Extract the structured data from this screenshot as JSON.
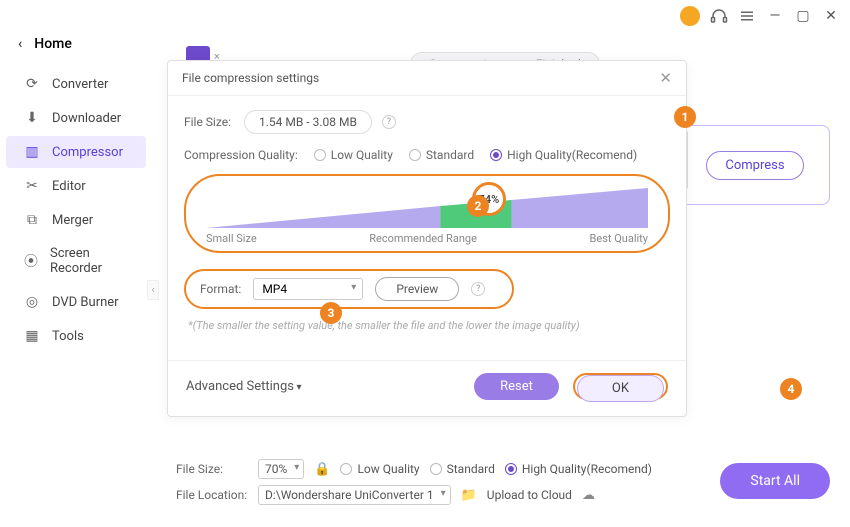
{
  "home": "Home",
  "sidebar": {
    "items": [
      {
        "label": "Converter"
      },
      {
        "label": "Downloader"
      },
      {
        "label": "Compressor"
      },
      {
        "label": "Editor"
      },
      {
        "label": "Merger"
      },
      {
        "label": "Screen Recorder"
      },
      {
        "label": "DVD Burner"
      },
      {
        "label": "Tools"
      }
    ]
  },
  "tabs": {
    "compressing": "Compressing",
    "finished": "Finished"
  },
  "card": {
    "compress": "Compress"
  },
  "dialog": {
    "title": "File compression settings",
    "filesize_label": "File Size:",
    "filesize_value": "1.54 MB - 3.08 MB",
    "cq_label": "Compression Quality:",
    "low": "Low Quality",
    "standard": "Standard",
    "high": "High Quality(Recomend)",
    "percent": "74%",
    "smallsize": "Small Size",
    "recommended": "Recommended Range",
    "best": "Best Quality",
    "format_label": "Format:",
    "format_value": "MP4",
    "preview": "Preview",
    "hint": "*(The smaller the setting value, the smaller the file and the lower the image quality)",
    "advanced": "Advanced Settings",
    "reset": "Reset",
    "ok": "OK"
  },
  "bottom": {
    "filesize_label": "File Size:",
    "filesize_value": "70%",
    "low": "Low Quality",
    "standard": "Standard",
    "high": "High Quality(Recomend)",
    "location_label": "File Location:",
    "location_value": "D:\\Wondershare UniConverter 1",
    "upload": "Upload to Cloud",
    "startall": "Start All"
  },
  "badges": {
    "b1": "1",
    "b2": "2",
    "b3": "3",
    "b4": "4"
  }
}
